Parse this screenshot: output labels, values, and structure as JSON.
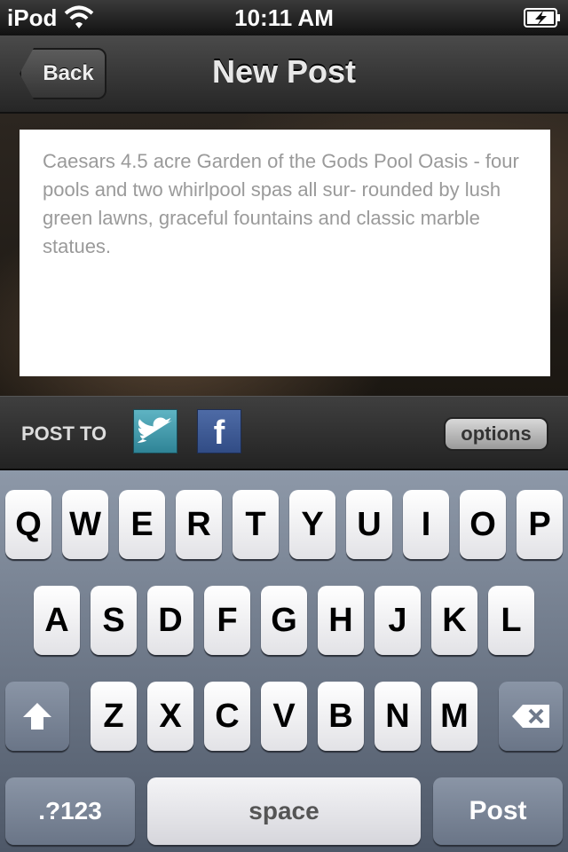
{
  "status_bar": {
    "carrier": "iPod",
    "time": "10:11 AM",
    "wifi_icon": "wifi-icon",
    "battery_icon": "battery-charging-icon"
  },
  "nav": {
    "back_label": "Back",
    "title": "New Post"
  },
  "post": {
    "text": "Caesars 4.5 acre Garden of the Gods Pool Oasis - four pools and two whirlpool spas all sur- rounded by lush green lawns, graceful fountains and classic marble statues."
  },
  "post_to": {
    "label": "POST TO",
    "twitter_icon": "twitter-icon",
    "facebook_icon": "facebook-icon",
    "facebook_glyph": "f",
    "options_label": "options",
    "twitter_color": "#3a8fa0",
    "facebook_color": "#3b5998"
  },
  "keyboard": {
    "row1": [
      "Q",
      "W",
      "E",
      "R",
      "T",
      "Y",
      "U",
      "I",
      "O",
      "P"
    ],
    "row2": [
      "A",
      "S",
      "D",
      "F",
      "G",
      "H",
      "J",
      "K",
      "L"
    ],
    "row3": [
      "Z",
      "X",
      "C",
      "V",
      "B",
      "N",
      "M"
    ],
    "numbers_label": ".?123",
    "space_label": "space",
    "post_label": "Post",
    "shift_icon": "shift-arrow-icon",
    "delete_icon": "backspace-icon"
  }
}
